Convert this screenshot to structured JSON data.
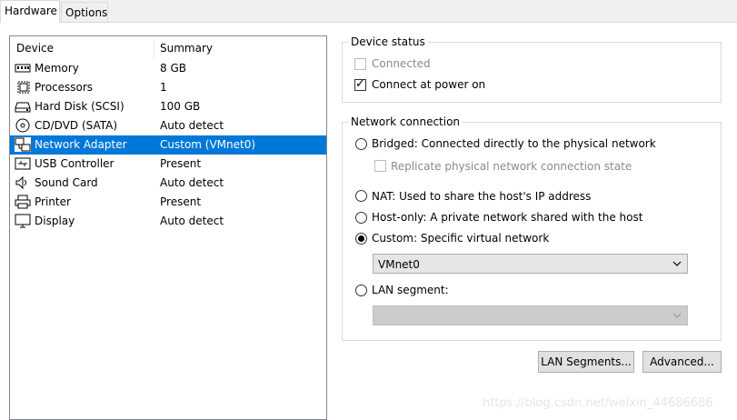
{
  "tabs": [
    {
      "label": "Hardware"
    },
    {
      "label": "Options"
    }
  ],
  "device_list": {
    "col_device": "Device",
    "col_summary": "Summary",
    "items": [
      {
        "name": "Memory",
        "summary": "8 GB"
      },
      {
        "name": "Processors",
        "summary": "1"
      },
      {
        "name": "Hard Disk (SCSI)",
        "summary": "100 GB"
      },
      {
        "name": "CD/DVD (SATA)",
        "summary": "Auto detect"
      },
      {
        "name": "Network Adapter",
        "summary": "Custom (VMnet0)"
      },
      {
        "name": "USB Controller",
        "summary": "Present"
      },
      {
        "name": "Sound Card",
        "summary": "Auto detect"
      },
      {
        "name": "Printer",
        "summary": "Present"
      },
      {
        "name": "Display",
        "summary": "Auto detect"
      }
    ]
  },
  "device_status": {
    "title": "Device status",
    "connected_label": "Connected",
    "connect_power_label": "Connect at power on"
  },
  "network_connection": {
    "title": "Network connection",
    "bridged_label": "Bridged: Connected directly to the physical network",
    "replicate_label": "Replicate physical network connection state",
    "nat_label": "NAT: Used to share the host's IP address",
    "hostonly_label": "Host-only: A private network shared with the host",
    "custom_label": "Custom: Specific virtual network",
    "custom_value": "VMnet0",
    "lan_label": "LAN segment:"
  },
  "buttons": {
    "lan_segments": "LAN Segments...",
    "advanced": "Advanced..."
  },
  "watermark": "https://blog.csdn.net/weixin_44686686",
  "colors": {
    "selection": "#0078d7"
  }
}
